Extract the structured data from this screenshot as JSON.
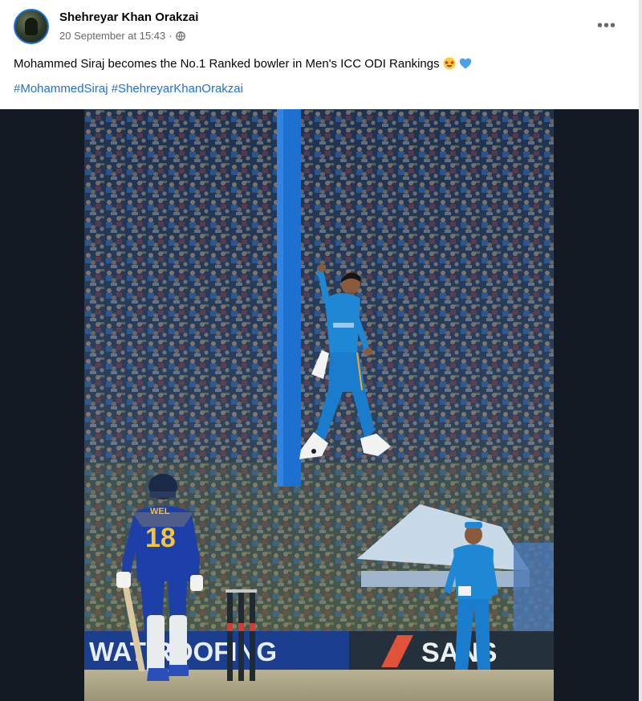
{
  "author": {
    "name": "Shehreyar Khan Orakzai"
  },
  "post_meta": {
    "timestamp": "20 September at 15:43",
    "separator": "·",
    "audience_icon": "globe-icon"
  },
  "more_options": {
    "label": "•••",
    "icon": "more-horizontal-icon"
  },
  "post": {
    "text": "Mohammed Siraj becomes the No.1 Ranked bowler in Men's ICC ODI Rankings",
    "emojis": [
      "star-struck-emoji",
      "blue-heart-emoji"
    ],
    "hashtags": [
      "#MohammedSiraj",
      "#ShehreyarKhanOrakzai"
    ]
  },
  "photo": {
    "jersey_number": "18",
    "jersey_name": "WEL",
    "banner_left": "WAT   ROOFING",
    "banner_right": "SANS"
  },
  "colors": {
    "link": "#216fdb",
    "secondary_text": "#65676b",
    "media_background": "#131a24",
    "india_blue": "#1e88d4",
    "sri_lanka_blue": "#1c3fa8"
  }
}
